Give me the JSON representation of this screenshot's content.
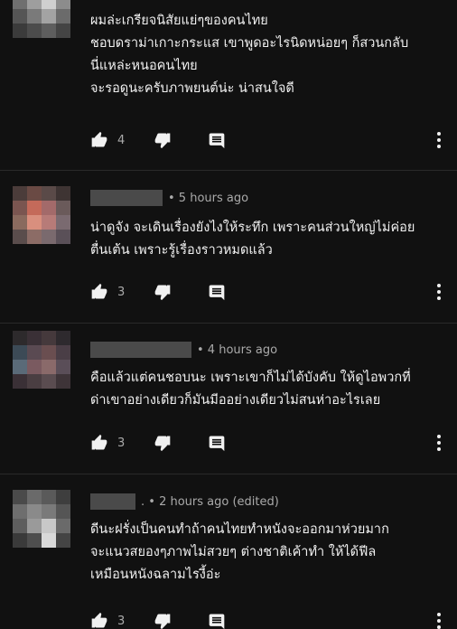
{
  "comments": [
    {
      "header_meta": "",
      "lines": [
        "ผมล่ะเกรียจนิสัยแย่ๆของคนไทย",
        "ชอบดราม่าเกาะกระแส เขาพูดอะไรนิดหน่อยๆ ก็สวนกลับ",
        "นี่แหล่ะหนอคนไทย",
        "จะรอดูนะครับภาพยนต์น่ะ น่าสนใจดี"
      ],
      "likes": "4",
      "avatar_colors": [
        "#9a9a9a",
        "#bdbdbd",
        "#d8d8d8",
        "#b0b0b0",
        "#6f6f6f",
        "#9e9e9e",
        "#cfcfcf",
        "#8c8c8c",
        "#555555",
        "#7a7a7a",
        "#a3a3a3",
        "#6b6b6b",
        "#3b3b3b",
        "#4c4c4c",
        "#5e5e5e",
        "#444444"
      ]
    },
    {
      "header_meta": "• 5 hours ago",
      "lines": [
        "น่าดูจัง จะเดินเรื่องยังไงให้ระทึก เพราะคนส่วนใหญ่ไม่ค่อย",
        "ตื่นเต้น เพราะรู้เรื่องราวหมดแล้ว"
      ],
      "likes": "3",
      "avatar_colors": [
        "#4b3c3a",
        "#6a4a44",
        "#5a4a48",
        "#3e3433",
        "#7a5550",
        "#c46a5a",
        "#a36a6a",
        "#6a5a5a",
        "#8a6a5e",
        "#d98f7e",
        "#b77b78",
        "#7a6a70",
        "#5a4d4c",
        "#8c6c66",
        "#7a6a6e",
        "#5a5058"
      ]
    },
    {
      "header_meta": "• 4 hours ago",
      "lines": [
        "คือแล้วแต่คนชอบนะ เพราะเขาก็ไม่ได้บังคับ ให้ดูไอพวกที่",
        "ด่าเขาอย่างเดียวก็มันมีออย่างเดียวไม่สนห่าอะไรเลย"
      ],
      "likes": "3",
      "avatar_colors": [
        "#2d2a2c",
        "#3a3036",
        "#45393c",
        "#2e2a2e",
        "#3c4a56",
        "#5a4a52",
        "#6a4e50",
        "#4a3e46",
        "#5a6a78",
        "#7a5a60",
        "#8a6a6a",
        "#5a4e58",
        "#3a3036",
        "#4a3e42",
        "#5a4c50",
        "#3e3438"
      ]
    },
    {
      "header_meta": ". • 2 hours ago (edited)",
      "lines": [
        "ดีนะฝรั่งเป็นคนทำถ้าคนไทยทำหนังจะออกมาห่วยมาก",
        "จะแนวสยองๆภาพไม่สวยๆ ต่างชาติเค้าทำ ให้ได้ฟีล",
        "เหมือนหนังฉลามไรงี้อ่ะ"
      ],
      "likes": "3",
      "avatar_colors": [
        "#4a4a4a",
        "#6a6a6a",
        "#5a5a5a",
        "#3e3e3e",
        "#6e6e6e",
        "#8a8a8a",
        "#7a7a7a",
        "#555555",
        "#5e5e5e",
        "#9a9a9a",
        "#c8c8c8",
        "#6a6a6a",
        "#3a3a3a",
        "#4e4e4e",
        "#d9d9d9",
        "#444444"
      ]
    }
  ],
  "icons": {
    "like": "thumb-up-icon",
    "dislike": "thumb-down-icon",
    "reply": "reply-icon",
    "more": "more-vertical-icon"
  },
  "colors": {
    "background": "#111111",
    "text": "#f1f1f1",
    "secondary_text": "#aaaaaa",
    "icon": "#f1f1f1"
  }
}
